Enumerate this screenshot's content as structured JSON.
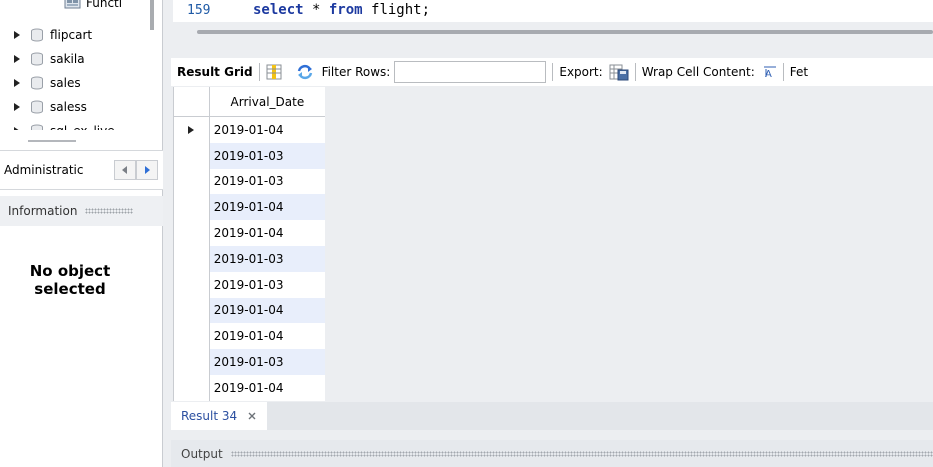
{
  "sidebar": {
    "functions_label": "Functi",
    "schemas": [
      {
        "name": "flipcart"
      },
      {
        "name": "sakila"
      },
      {
        "name": "sales"
      },
      {
        "name": "saless"
      },
      {
        "name": "sql_ex_live"
      }
    ],
    "admin_tab_label": "Administratic",
    "info_label": "Information",
    "no_object_text_line1": "No object",
    "no_object_text_line2": "selected"
  },
  "editor": {
    "line_number": "159",
    "sql_keyword1": "select",
    "sql_star": " * ",
    "sql_keyword2": "from",
    "sql_table": " flight;"
  },
  "toolbar": {
    "result_grid_label": "Result Grid",
    "filter_rows_label": "Filter Rows:",
    "filter_value": "",
    "export_label": "Export:",
    "wrap_label": "Wrap Cell Content:",
    "fetch_label": "Fet"
  },
  "grid": {
    "column": "Arrival_Date",
    "rows": [
      "2019-01-04",
      "2019-01-03",
      "2019-01-03",
      "2019-01-04",
      "2019-01-04",
      "2019-01-03",
      "2019-01-03",
      "2019-01-04",
      "2019-01-04",
      "2019-01-03",
      "2019-01-04"
    ]
  },
  "result_tab": {
    "label": "Result 34"
  },
  "output": {
    "label": "Output"
  },
  "colors": {
    "accent_blue": "#1d3aa0",
    "row_alt": "#e8eefb",
    "panel_bg": "#eceef1"
  }
}
